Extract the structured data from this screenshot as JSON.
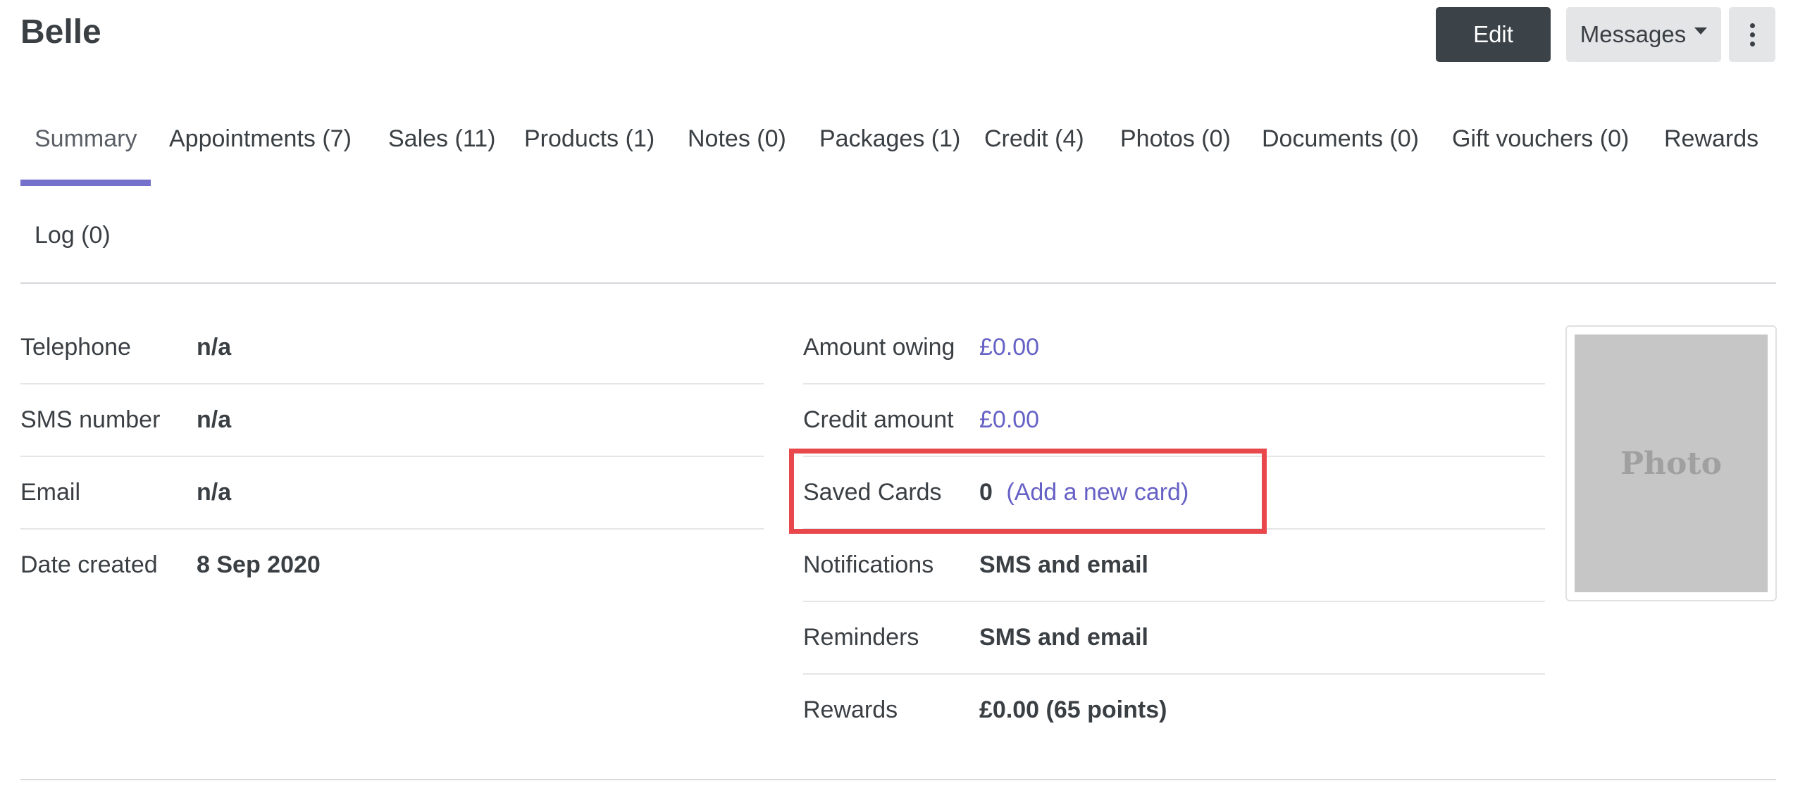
{
  "client": {
    "name": "Belle"
  },
  "actions": {
    "edit_label": "Edit",
    "messages_label": "Messages",
    "more_icon": "vertical-ellipsis-icon"
  },
  "tabs": [
    {
      "label": "Summary",
      "active": true
    },
    {
      "label": "Appointments (7)"
    },
    {
      "label": "Sales (11)"
    },
    {
      "label": "Products (1)"
    },
    {
      "label": "Notes (0)"
    },
    {
      "label": "Packages (1)"
    },
    {
      "label": "Credit (4)"
    },
    {
      "label": "Photos (0)"
    },
    {
      "label": "Documents (0)"
    },
    {
      "label": "Gift vouchers (0)"
    },
    {
      "label": "Rewards"
    },
    {
      "label": "Log (0)"
    }
  ],
  "contact": {
    "telephone": {
      "label": "Telephone",
      "value": "n/a"
    },
    "sms": {
      "label": "SMS number",
      "value": "n/a"
    },
    "email": {
      "label": "Email",
      "value": "n/a"
    },
    "date_created": {
      "label": "Date created",
      "value": "8 Sep 2020"
    }
  },
  "account": {
    "amount_owing": {
      "label": "Amount owing",
      "value": "£0.00"
    },
    "credit_amount": {
      "label": "Credit amount",
      "value": "£0.00"
    },
    "saved_cards": {
      "label": "Saved Cards",
      "count": "0",
      "link": "(Add a new card)"
    },
    "notifications": {
      "label": "Notifications",
      "value": "SMS and email"
    },
    "reminders": {
      "label": "Reminders",
      "value": "SMS and email"
    },
    "rewards": {
      "label": "Rewards",
      "value": "£0.00 (65 points)"
    }
  },
  "photo": {
    "placeholder": "Photo"
  },
  "colors": {
    "accent": "#7470cb",
    "link": "#6661c5",
    "highlight": "#e8474c",
    "primary_button": "#3b4248"
  }
}
